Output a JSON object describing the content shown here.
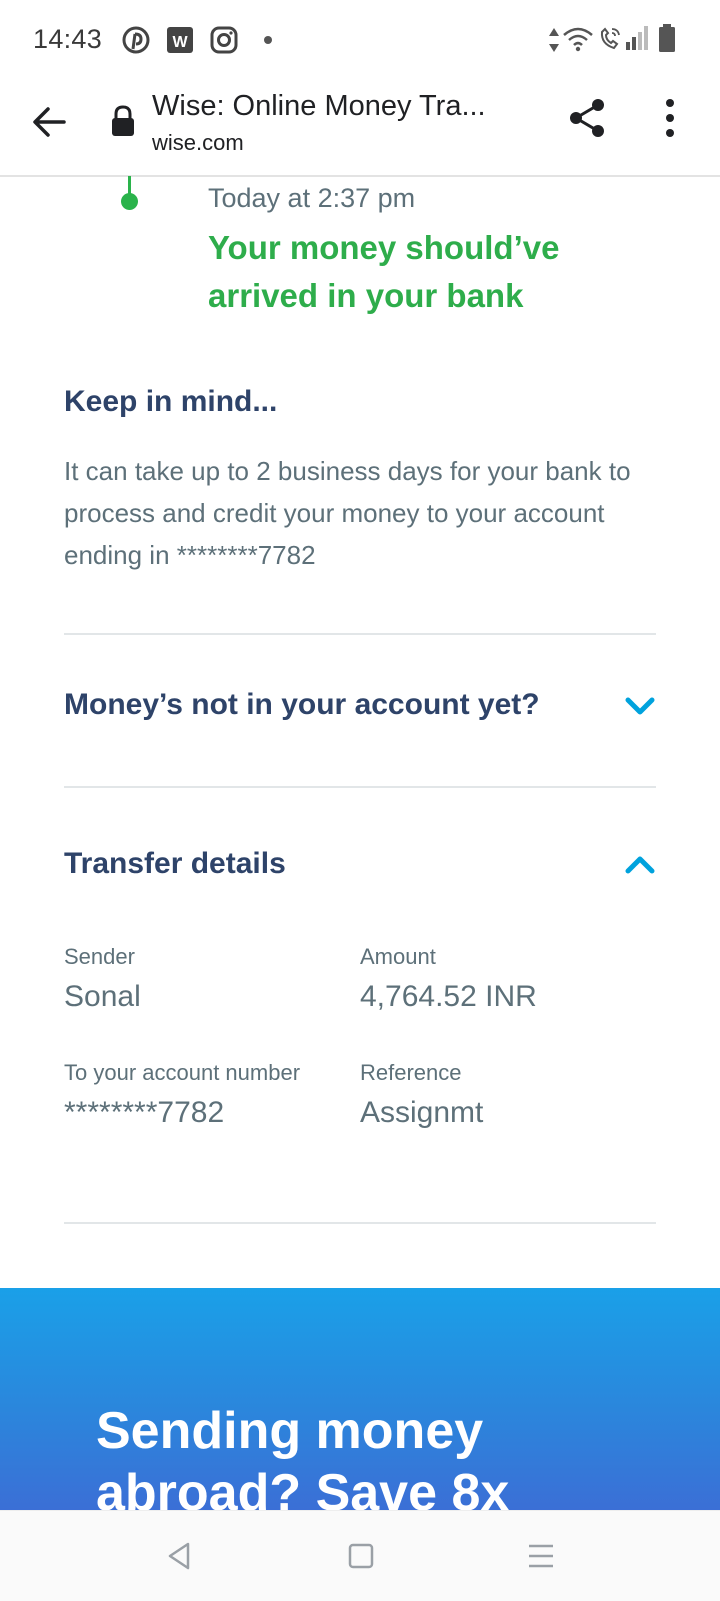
{
  "status_bar": {
    "time": "14:43",
    "icons": [
      "pinterest-icon",
      "word-app-icon",
      "instagram-icon",
      "notification-dot",
      "data-arrows-icon",
      "wifi-icon",
      "wifi-calling-icon",
      "signal-icon",
      "battery-icon"
    ]
  },
  "browser": {
    "title": "Wise: Online Money Tra...",
    "url": "wise.com",
    "icons": [
      "back-arrow-icon",
      "lock-icon",
      "share-icon",
      "overflow-menu-icon"
    ]
  },
  "timeline": {
    "time": "Today at 2:37 pm",
    "status": "Your money should’ve arrived in your bank",
    "accent_color": "#2ead4b"
  },
  "keep_in_mind": {
    "heading": "Keep in mind...",
    "body": "It can take up to 2 business days for your bank to process and credit your money to your account ending in ********7782"
  },
  "faq": {
    "title": "Money’s not in your account yet?",
    "expanded": false
  },
  "transfer_details": {
    "title": "Transfer details",
    "expanded": true,
    "fields": {
      "sender": {
        "label": "Sender",
        "value": "Sonal"
      },
      "amount": {
        "label": "Amount",
        "value": "4,764.52 INR"
      },
      "account": {
        "label": "To your account number",
        "value": "********7782"
      },
      "reference": {
        "label": "Reference",
        "value": "Assignmt"
      }
    }
  },
  "promo": {
    "text": "Sending money abroad? Save 8x"
  },
  "nav_bar": {
    "icons": [
      "back-triangle-icon",
      "home-square-icon",
      "recents-menu-icon"
    ]
  },
  "colors": {
    "heading": "#2e4369",
    "body_text": "#5d7079",
    "chevron": "#00a2dd",
    "promo_blue": "#1aa0e8"
  }
}
